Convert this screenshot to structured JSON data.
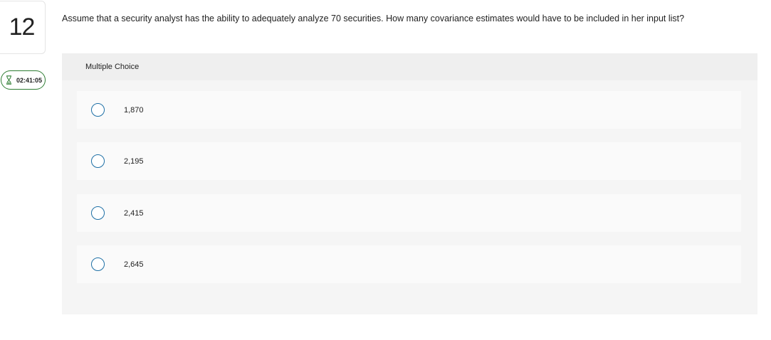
{
  "question": {
    "number": "12",
    "text": "Assume that a security analyst has the ability to adequately analyze 70 securities. How many covariance estimates would have to be included in her input list?"
  },
  "timer": {
    "value": "02:41:05",
    "icon": "hourglass-icon"
  },
  "choices": {
    "header": "Multiple Choice",
    "options": [
      {
        "label": "1,870"
      },
      {
        "label": "2,195"
      },
      {
        "label": "2,415"
      },
      {
        "label": "2,645"
      }
    ]
  },
  "colors": {
    "radio_border": "#1d6fa5",
    "timer_border": "#2e7d32"
  }
}
